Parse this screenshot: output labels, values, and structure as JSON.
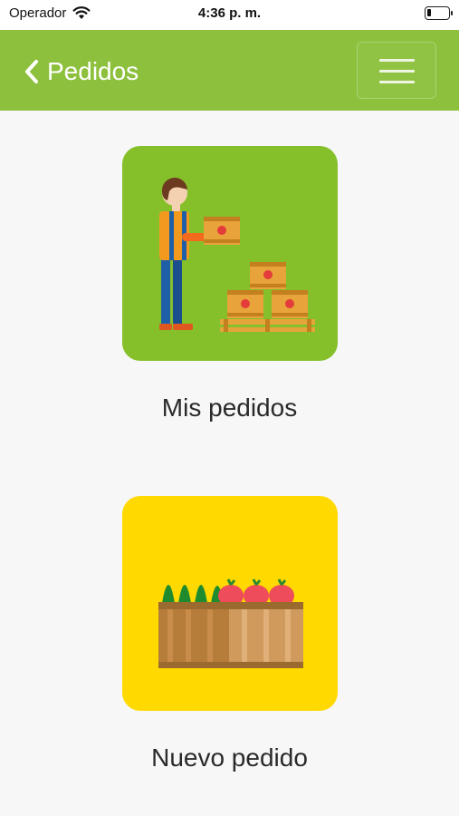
{
  "status_bar": {
    "carrier": "Operador",
    "time": "4:36 p. m.",
    "wifi_icon": "wifi-icon",
    "battery_icon": "battery-icon"
  },
  "navbar": {
    "back_label": "Pedidos",
    "back_icon": "chevron-left-icon",
    "menu_icon": "hamburger-menu-icon",
    "background_color": "#8dc03d"
  },
  "options": [
    {
      "label": "Mis pedidos",
      "icon": "worker-with-boxes-illustration",
      "tile_color": "#85bf2a"
    },
    {
      "label": "Nuevo pedido",
      "icon": "produce-crate-illustration",
      "tile_color": "#ffd900"
    }
  ]
}
